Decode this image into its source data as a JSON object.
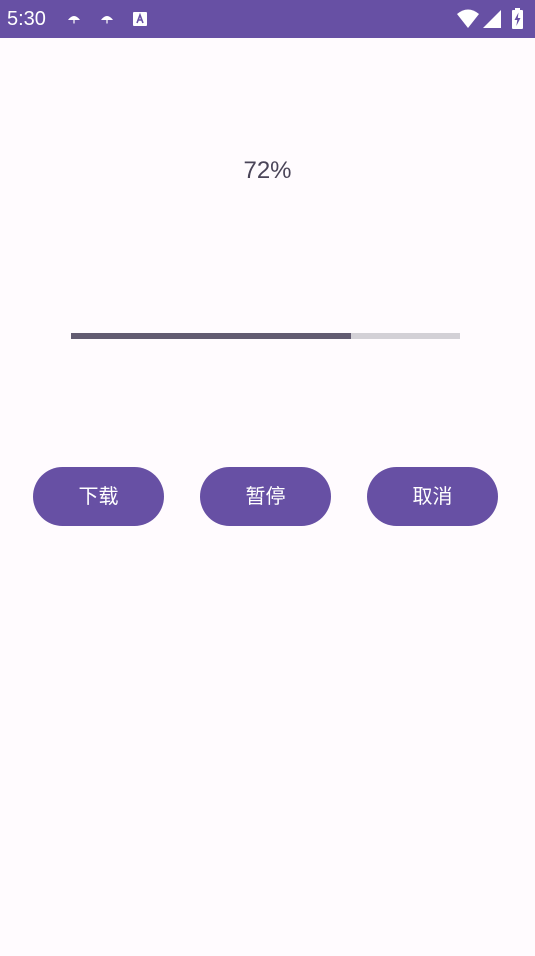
{
  "status_bar": {
    "time": "5:30",
    "notification_icons": [
      "umbrella-icon",
      "umbrella-icon",
      "font-a-icon"
    ],
    "system_icons": [
      "wifi-icon",
      "cell-signal-icon",
      "battery-charging-icon"
    ],
    "background_color": "#6750a4"
  },
  "progress": {
    "text": "72%",
    "value": 0.72,
    "fill_color": "#625b71",
    "track_color": "#d3d0d6"
  },
  "buttons": {
    "download_label": "下载",
    "pause_label": "暂停",
    "cancel_label": "取消",
    "color": "#6750a4"
  }
}
